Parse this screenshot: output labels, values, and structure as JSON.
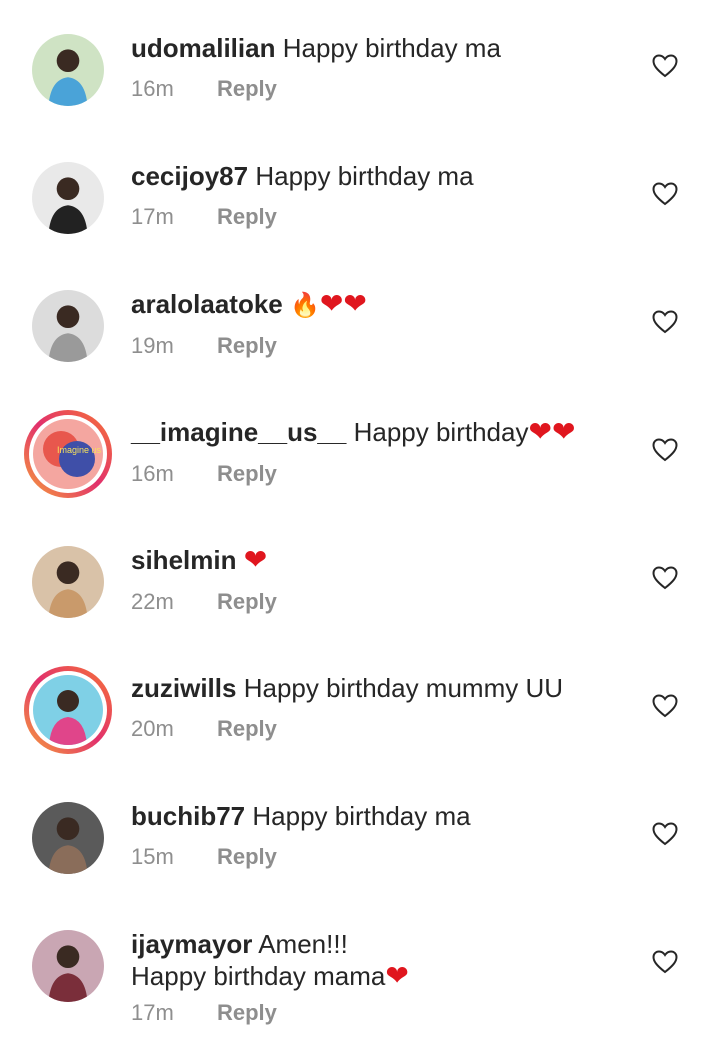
{
  "comments": [
    {
      "user": "udomalilian",
      "text": "Happy birthday ma",
      "emoji": "",
      "line2": "",
      "emoji2": "",
      "time": "16m",
      "reply": "Reply",
      "story": false,
      "avatar_color": "#4aa3d8"
    },
    {
      "user": "cecijoy87",
      "text": "Happy birthday ma",
      "emoji": "",
      "line2": "",
      "emoji2": "",
      "time": "17m",
      "reply": "Reply",
      "story": false,
      "avatar_color": "#222222"
    },
    {
      "user": "aralolaatoke",
      "text": "",
      "emoji": "🔥❤❤",
      "line2": "",
      "emoji2": "",
      "time": "19m",
      "reply": "Reply",
      "story": false,
      "avatar_color": "#9a9a9a"
    },
    {
      "user": "__imagine__us__",
      "text": "Happy birthday",
      "emoji": "❤❤",
      "line2": "",
      "emoji2": "",
      "time": "16m",
      "reply": "Reply",
      "story": true,
      "avatar_color": "#e8574d",
      "avatar_text": "Imagine us"
    },
    {
      "user": "sihelmin",
      "text": "",
      "emoji": "❤",
      "line2": "",
      "emoji2": "",
      "time": "22m",
      "reply": "Reply",
      "story": false,
      "avatar_color": "#c99a6b"
    },
    {
      "user": "zuziwills",
      "text": "Happy birthday mummy UU",
      "emoji": "",
      "line2": "",
      "emoji2": "",
      "time": "20m",
      "reply": "Reply",
      "story": true,
      "avatar_color": "#e0458a"
    },
    {
      "user": "buchib77",
      "text": "Happy birthday ma",
      "emoji": "",
      "line2": "",
      "emoji2": "",
      "time": "15m",
      "reply": "Reply",
      "story": false,
      "avatar_color": "#8a6d5a"
    },
    {
      "user": "ijaymayor",
      "text": "Amen!!!",
      "emoji": "",
      "line2": "Happy birthday mama",
      "emoji2": "❤",
      "time": "17m",
      "reply": "Reply",
      "story": false,
      "avatar_color": "#7a2e3a"
    }
  ],
  "icons": {
    "like": "heart-outline-icon"
  }
}
